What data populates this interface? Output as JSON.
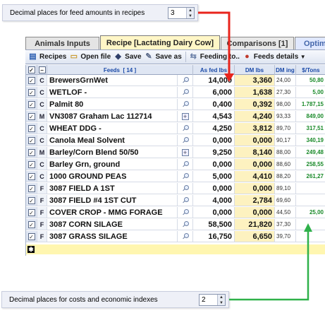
{
  "top_callout": {
    "label": "Decimal places for feed amounts in recipes",
    "value": "3"
  },
  "bottom_callout": {
    "label": "Decimal places for costs and economic indexes",
    "value": "2"
  },
  "tabs": [
    {
      "label": "Animals Inputs"
    },
    {
      "label": "Recipe [Lactating Dairy Cow]"
    },
    {
      "label": "Comparisons [1]"
    },
    {
      "label": "Optim"
    }
  ],
  "toolbar": {
    "recipes": "Recipes",
    "open_file": "Open file",
    "save": "Save",
    "save_as": "Save as",
    "feeding_to": "Feeding to..",
    "feeds_details": "Feeds details"
  },
  "grid": {
    "columns": {
      "feeds": "Feeds",
      "feeds_count": "[ 14 ]",
      "as_fed": "As fed lbs",
      "dm": "DM lbs",
      "dm_ing": "DM ing",
      "cost": "$/Tons"
    },
    "rows": [
      {
        "type": "C",
        "name": "BrewersGrnWet",
        "icon": "magnifier",
        "as_fed": "14,000",
        "dm": "3,360",
        "dm_ing": "24,00",
        "cost": "50,80"
      },
      {
        "type": "C",
        "name": "WETLOF -",
        "icon": "magnifier",
        "as_fed": "6,000",
        "dm": "1,638",
        "dm_ing": "27,30",
        "cost": "5,00"
      },
      {
        "type": "C",
        "name": "Palmit 80",
        "icon": "magnifier",
        "as_fed": "0,400",
        "dm": "0,392",
        "dm_ing": "98,00",
        "cost": "1.787,15"
      },
      {
        "type": "M",
        "name": "VN3087 Graham Lac 112714",
        "icon": "plus",
        "as_fed": "4,543",
        "dm": "4,240",
        "dm_ing": "93,33",
        "cost": "849,00"
      },
      {
        "type": "C",
        "name": "WHEAT DDG -",
        "icon": "magnifier",
        "as_fed": "4,250",
        "dm": "3,812",
        "dm_ing": "89,70",
        "cost": "317,51"
      },
      {
        "type": "C",
        "name": "Canola Meal Solvent",
        "icon": "magnifier",
        "as_fed": "0,000",
        "dm": "0,000",
        "dm_ing": "90,17",
        "cost": "340,19"
      },
      {
        "type": "M",
        "name": "Barley/Corn Blend 50/50",
        "icon": "plus",
        "as_fed": "9,250",
        "dm": "8,140",
        "dm_ing": "88,00",
        "cost": "249,48"
      },
      {
        "type": "C",
        "name": "Barley Grn, ground",
        "icon": "magnifier",
        "as_fed": "0,000",
        "dm": "0,000",
        "dm_ing": "88,60",
        "cost": "258,55"
      },
      {
        "type": "C",
        "name": "1000 GROUND PEAS",
        "icon": "magnifier",
        "as_fed": "5,000",
        "dm": "4,410",
        "dm_ing": "88,20",
        "cost": "261,27"
      },
      {
        "type": "F",
        "name": "3087 FIELD A 1ST",
        "icon": "magnifier",
        "as_fed": "0,000",
        "dm": "0,000",
        "dm_ing": "89,10",
        "cost": ""
      },
      {
        "type": "F",
        "name": "3087 FIELD #4 1ST CUT",
        "icon": "magnifier",
        "as_fed": "4,000",
        "dm": "2,784",
        "dm_ing": "69,60",
        "cost": ""
      },
      {
        "type": "F",
        "name": "COVER CROP - MMG FORAGE",
        "icon": "magnifier",
        "as_fed": "0,000",
        "dm": "0,000",
        "dm_ing": "44,50",
        "cost": "25,00"
      },
      {
        "type": "F",
        "name": "3087 CORN SILAGE",
        "icon": "magnifier",
        "as_fed": "58,500",
        "dm": "21,820",
        "dm_ing": "37,30",
        "cost": ""
      },
      {
        "type": "F",
        "name": "3087 GRASS SILAGE",
        "icon": "magnifier",
        "as_fed": "16,750",
        "dm": "6,650",
        "dm_ing": "39,70",
        "cost": ""
      }
    ],
    "new_row_marker": "✱"
  },
  "colors": {
    "red_arrow": "#e8241c",
    "green_arrow": "#2fb14a",
    "cost_text": "#1a8a2a",
    "dm_column": "#fdf2c0"
  }
}
